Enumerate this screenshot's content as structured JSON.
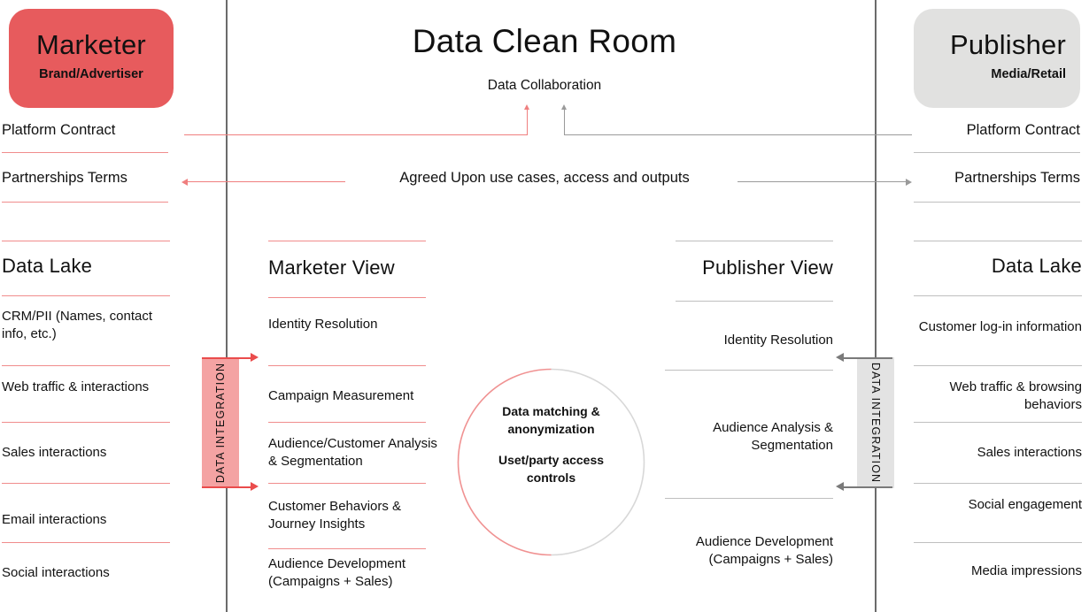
{
  "diagram": {
    "title": "Data Clean Room",
    "subtitle": "Data Collaboration",
    "center_connector_label": "Agreed Upon use cases, access and outputs"
  },
  "marketer": {
    "name": "Marketer",
    "role": "Brand/Advertiser",
    "color": "#E75B5D",
    "contract_labels": [
      "Platform Contract",
      "Partnerships Terms"
    ]
  },
  "publisher": {
    "name": "Publisher",
    "role": "Media/Retail",
    "color": "#E1E1E0",
    "contract_labels": [
      "Platform Contract",
      "Partnerships Terms"
    ]
  },
  "marketer_data_lake": {
    "header": "Data Lake",
    "items": [
      "CRM/PII (Names, contact info, etc.)",
      "Web traffic & interactions",
      "Sales interactions",
      "Email interactions",
      "Social interactions"
    ]
  },
  "marketer_view": {
    "header": "Marketer View",
    "items": [
      "Identity Resolution",
      "Campaign Measurement",
      "Audience/Customer Analysis & Segmentation",
      "Customer Behaviors & Journey Insights",
      "Audience Development (Campaigns + Sales)"
    ]
  },
  "publisher_view": {
    "header": "Publisher View",
    "items": [
      "Identity Resolution",
      "Audience Analysis & Segmentation",
      "Audience Development (Campaigns + Sales)"
    ]
  },
  "publisher_data_lake": {
    "header": "Data Lake",
    "items": [
      "Customer log-in information",
      "Web traffic & browsing behaviors",
      "Sales interactions",
      "Social engagement",
      "Media impressions"
    ]
  },
  "core": {
    "line1": "Data matching &",
    "line2": "anonymization",
    "line3": "Uset/party access",
    "line4": "controls"
  },
  "integration": {
    "left_label": "DATA INTEGRATION",
    "right_label": "DATA INTEGRATION"
  }
}
